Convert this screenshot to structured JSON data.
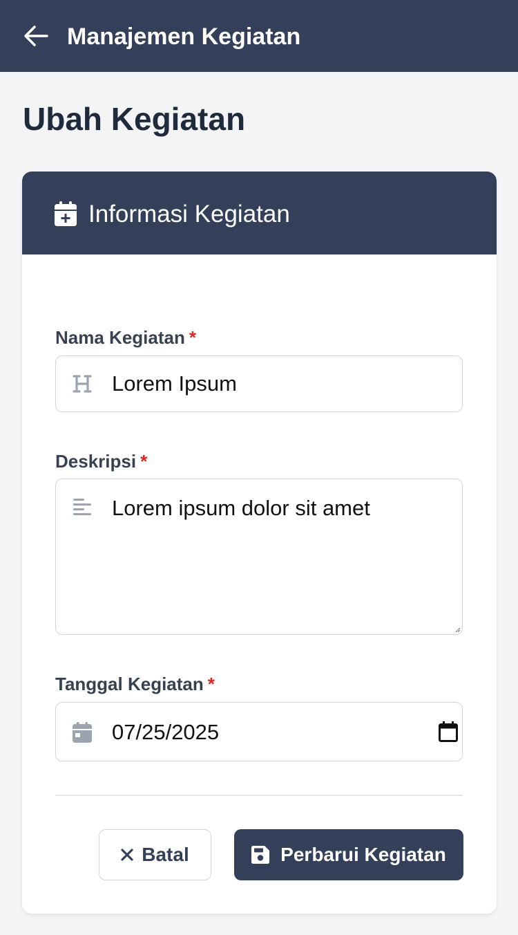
{
  "topbar": {
    "back_icon": "arrow-left-icon",
    "title": "Manajemen Kegiatan"
  },
  "page": {
    "title": "Ubah Kegiatan"
  },
  "card": {
    "header_icon": "calendar-plus-icon",
    "header_title": "Informasi Kegiatan"
  },
  "form": {
    "name": {
      "label": "Nama Kegiatan",
      "required_mark": "*",
      "icon": "heading-icon",
      "value": "Lorem Ipsum"
    },
    "description": {
      "label": "Deskripsi",
      "required_mark": "*",
      "icon": "align-left-icon",
      "value": "Lorem ipsum dolor sit amet"
    },
    "date": {
      "label": "Tanggal Kegiatan",
      "required_mark": "*",
      "icon": "calendar-icon",
      "value": "07/25/2025",
      "picker_icon": "calendar-picker-icon"
    }
  },
  "actions": {
    "cancel_label": "Batal",
    "cancel_icon": "close-icon",
    "save_label": "Perbarui Kegiatan",
    "save_icon": "save-icon"
  },
  "colors": {
    "primary": "#344059",
    "background": "#f3f4f6",
    "required": "#dc2626",
    "icon_muted": "#9ca3af"
  }
}
